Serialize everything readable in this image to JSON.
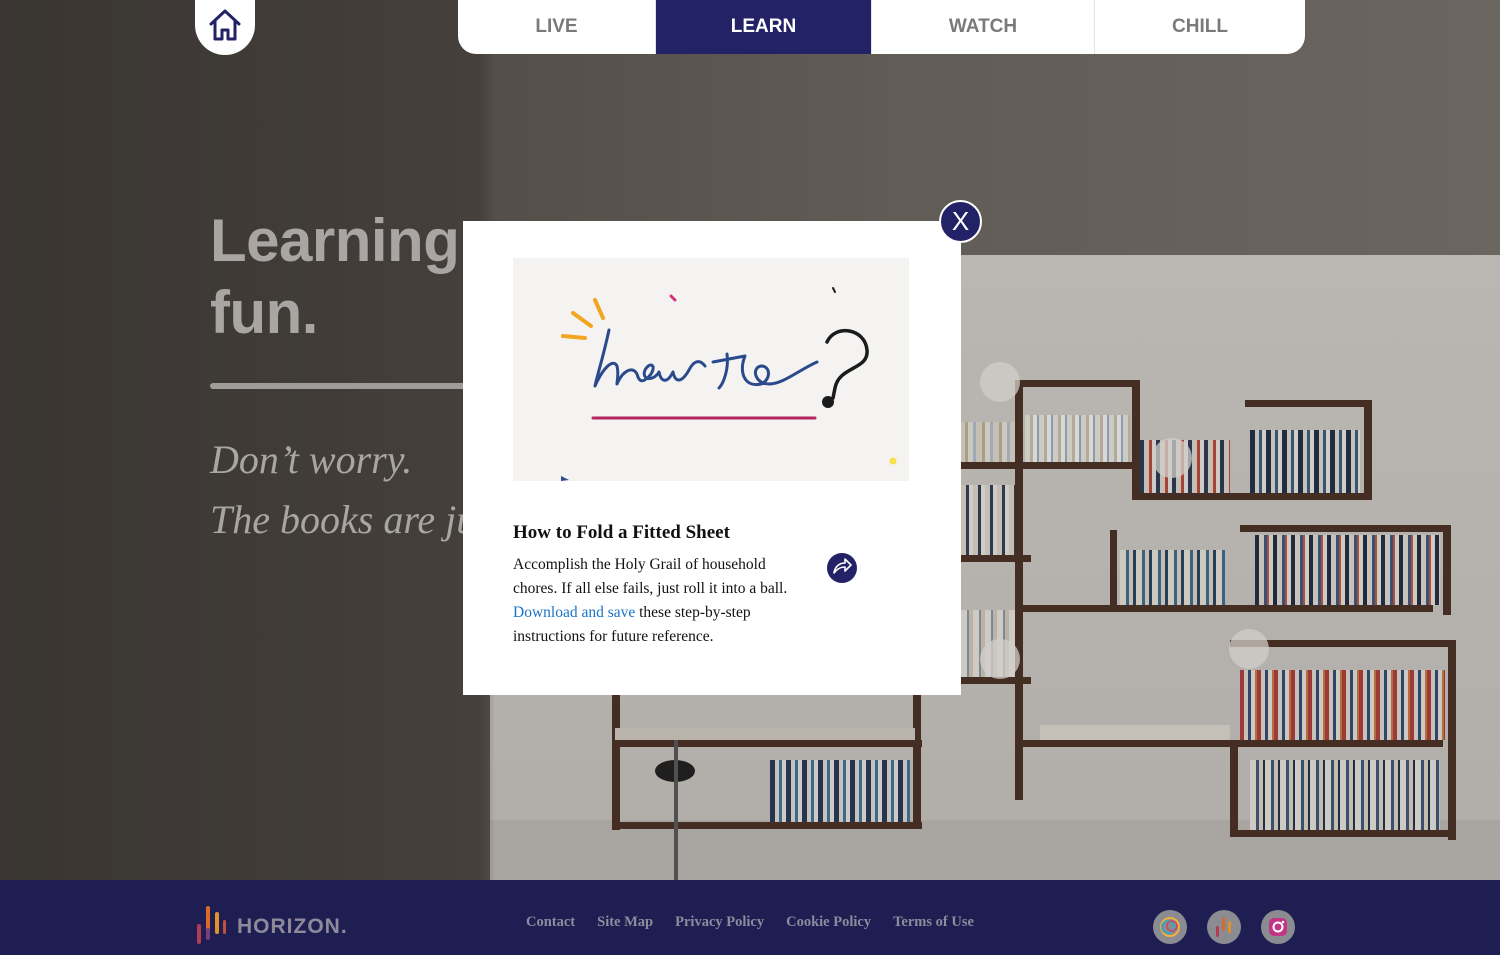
{
  "nav": {
    "tabs": [
      {
        "label": "LIVE",
        "active": false
      },
      {
        "label": "LEARN",
        "active": true
      },
      {
        "label": "WATCH",
        "active": false
      },
      {
        "label": "CHILL",
        "active": false
      }
    ],
    "active_color": "#232267"
  },
  "hero": {
    "title": "Learning n         thin            ak     fun.",
    "title_line1": "Learning n",
    "title_line2": "fun.",
    "sub1": "Don’t worry.",
    "sub2": "The books are ju"
  },
  "modal": {
    "close_label": "X",
    "image_text": "how to?",
    "title": "How to Fold a Fitted Sheet",
    "desc_part1": "Accomplish the Holy Grail of household chores. If all else fails, just roll it into a ball.",
    "link_label": "Download and save",
    "desc_part2": " these step-by-step instructions for future reference."
  },
  "footer": {
    "logo_text": "HORIZON.",
    "links": [
      "Contact",
      "Site Map",
      "Privacy Policy",
      "Cookie Policy",
      "Terms of Use"
    ],
    "social_icons": [
      "horizon-circle-icon",
      "horizon-logo-icon",
      "instagram-icon"
    ],
    "background": "#1f1e53"
  }
}
